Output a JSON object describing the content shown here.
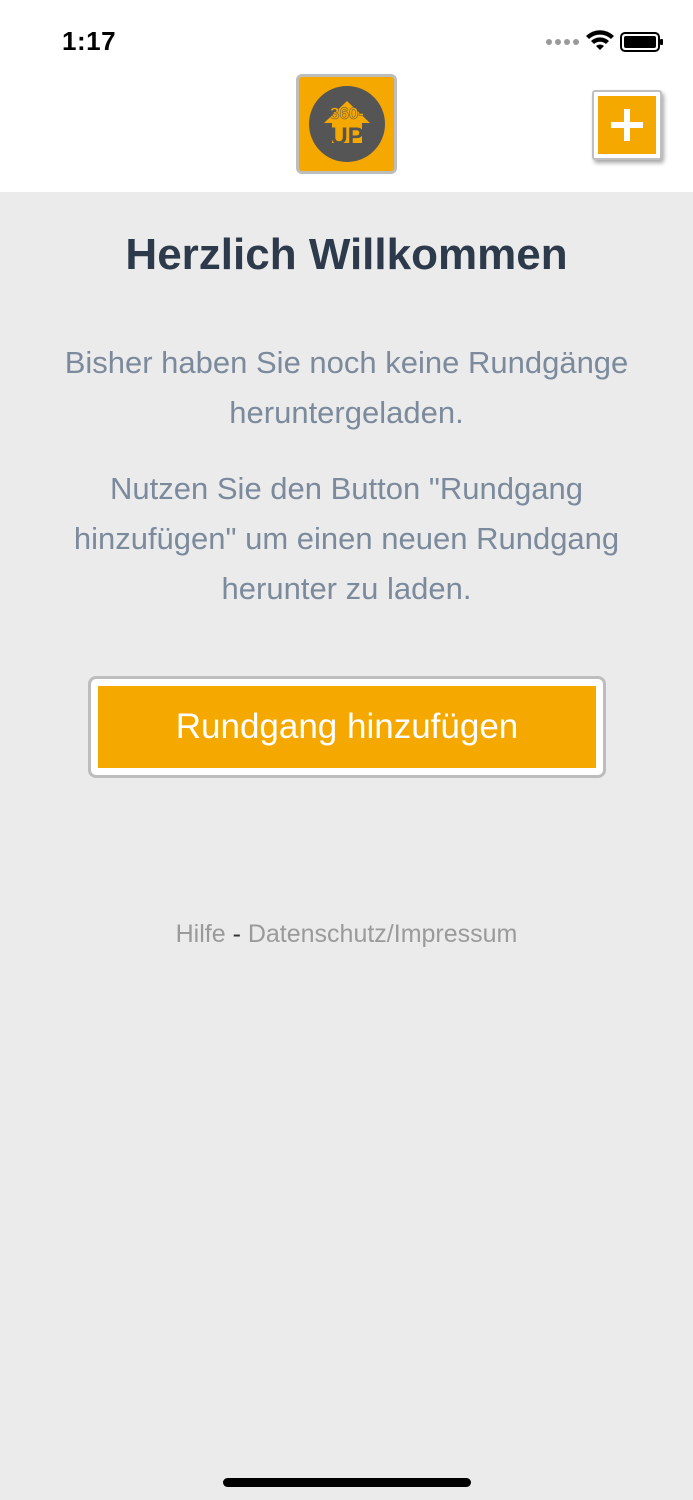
{
  "status_bar": {
    "time": "1:17",
    "icons": [
      "signal-dots-icon",
      "wifi-icon",
      "battery-icon"
    ]
  },
  "header": {
    "logo_text_top": "360-",
    "logo_text_bottom": "UP",
    "add_button_icon": "plus-icon"
  },
  "main": {
    "title": "Herzlich Willkommen",
    "intro": "Bisher haben Sie noch keine Rundgänge heruntergeladen.",
    "hint": "Nutzen Sie den Button \"Rundgang hinzufügen\" um einen neuen Rundgang herunter zu laden.",
    "add_tour_label": "Rundgang hinzufügen"
  },
  "footer": {
    "help_label": "Hilfe",
    "separator": "-",
    "privacy_label": "Datenschutz/Impressum"
  },
  "colors": {
    "accent": "#f5a800",
    "background": "#ebebeb",
    "title": "#2d3a4b",
    "body_text": "#7b8a9c",
    "logo_circle": "#555555"
  }
}
